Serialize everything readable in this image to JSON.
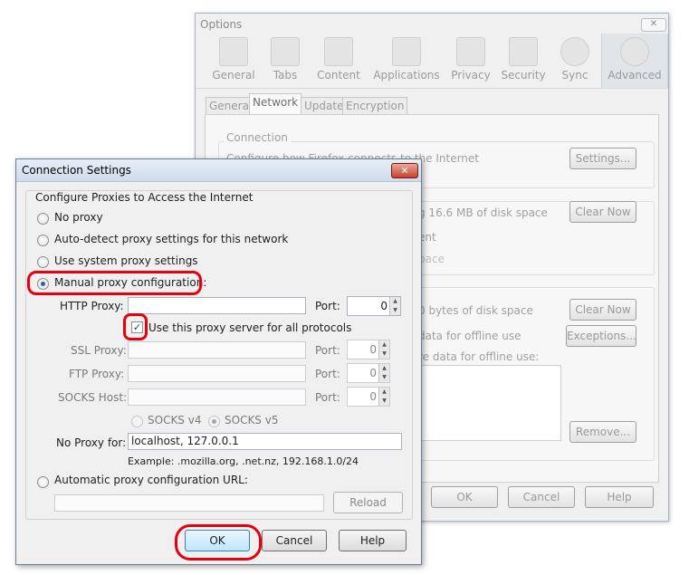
{
  "options": {
    "title": "Options",
    "close_glyph": "✕",
    "toolbar": [
      {
        "label": "General",
        "icon": "general-icon"
      },
      {
        "label": "Tabs",
        "icon": "tabs-icon"
      },
      {
        "label": "Content",
        "icon": "content-icon"
      },
      {
        "label": "Applications",
        "icon": "applications-icon"
      },
      {
        "label": "Privacy",
        "icon": "privacy-mask-icon"
      },
      {
        "label": "Security",
        "icon": "padlock-icon"
      },
      {
        "label": "Sync",
        "icon": "sync-icon"
      },
      {
        "label": "Advanced",
        "icon": "gear-icon"
      }
    ],
    "tabs": [
      "General",
      "Network",
      "Update",
      "Encryption"
    ],
    "active_tab": "Network",
    "connection_heading": "Connection",
    "connection_desc": "Configure how Firefox connects to the Internet",
    "settings_button": "Settings...",
    "cache_text": "g 16.6 MB of disk space",
    "cache_text2": "ent",
    "cache_text3": "pace",
    "clear_now_1": "Clear Now",
    "offline_text": "0 bytes of disk space",
    "offline_text2": "data for offline use",
    "offline_text3": "re data for offline use:",
    "clear_now_2": "Clear Now",
    "exceptions_button": "Exceptions...",
    "remove_button": "Remove...",
    "ok_button": "OK",
    "cancel_button": "Cancel",
    "help_button": "Help"
  },
  "connection_settings": {
    "title": "Connection Settings",
    "close_glyph": "✕",
    "group_title": "Configure Proxies to Access the Internet",
    "options": {
      "no_proxy": "No proxy",
      "auto_detect": "Auto-detect proxy settings for this network",
      "system": "Use system proxy settings",
      "manual": "Manual proxy configuration:",
      "auto_url": "Automatic proxy configuration URL:"
    },
    "selected": "manual",
    "http_proxy": {
      "label": "HTTP Proxy:",
      "value": "",
      "port_label": "Port:",
      "port": "0"
    },
    "use_same": {
      "label": "Use this proxy server for all protocols",
      "checked": true
    },
    "ssl_proxy": {
      "label": "SSL Proxy:",
      "value": "",
      "port_label": "Port:",
      "port": "0"
    },
    "ftp_proxy": {
      "label": "FTP Proxy:",
      "value": "",
      "port_label": "Port:",
      "port": "0"
    },
    "socks_host": {
      "label": "SOCKS Host:",
      "value": "",
      "port_label": "Port:",
      "port": "0"
    },
    "socks_v4": "SOCKS v4",
    "socks_v5": "SOCKS v5",
    "no_proxy_for": {
      "label": "No Proxy for:",
      "value": "localhost, 127.0.0.1"
    },
    "example": "Example: .mozilla.org, .net.nz, 192.168.1.0/24",
    "auto_url_value": "",
    "reload_button": "Reload",
    "ok_button": "OK",
    "cancel_button": "Cancel",
    "help_button": "Help"
  },
  "annotation_color": "#e8000e"
}
